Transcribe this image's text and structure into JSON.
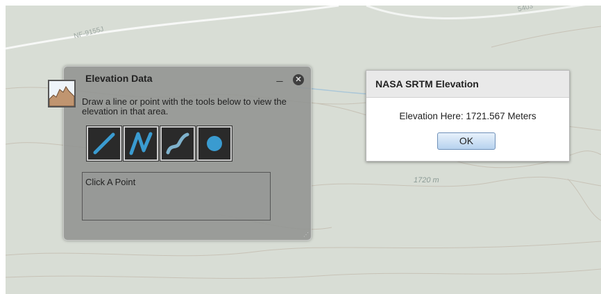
{
  "map": {
    "road_label": "NF-9155J",
    "road_label_2": "5403",
    "contour_label": "1720 m",
    "colors": {
      "background": "#d8ddd5",
      "road": "#ffffff",
      "contour": "#c7c2b6",
      "stream": "#a9c6d8"
    }
  },
  "widget": {
    "title": "Elevation Data",
    "minimize_label": "_",
    "close_label": "✕",
    "instructions": "Draw a line or point with the tools below to view the elevation in that area.",
    "tools": [
      {
        "icon": "line-tool-icon"
      },
      {
        "icon": "polyline-tool-icon"
      },
      {
        "icon": "freehand-tool-icon"
      },
      {
        "icon": "point-tool-icon"
      }
    ],
    "result_text": "Click A Point",
    "accent_color": "#3a9bd0"
  },
  "dialog": {
    "title": "NASA SRTM Elevation",
    "message": "Elevation Here: 1721.567 Meters",
    "ok_label": "OK"
  }
}
